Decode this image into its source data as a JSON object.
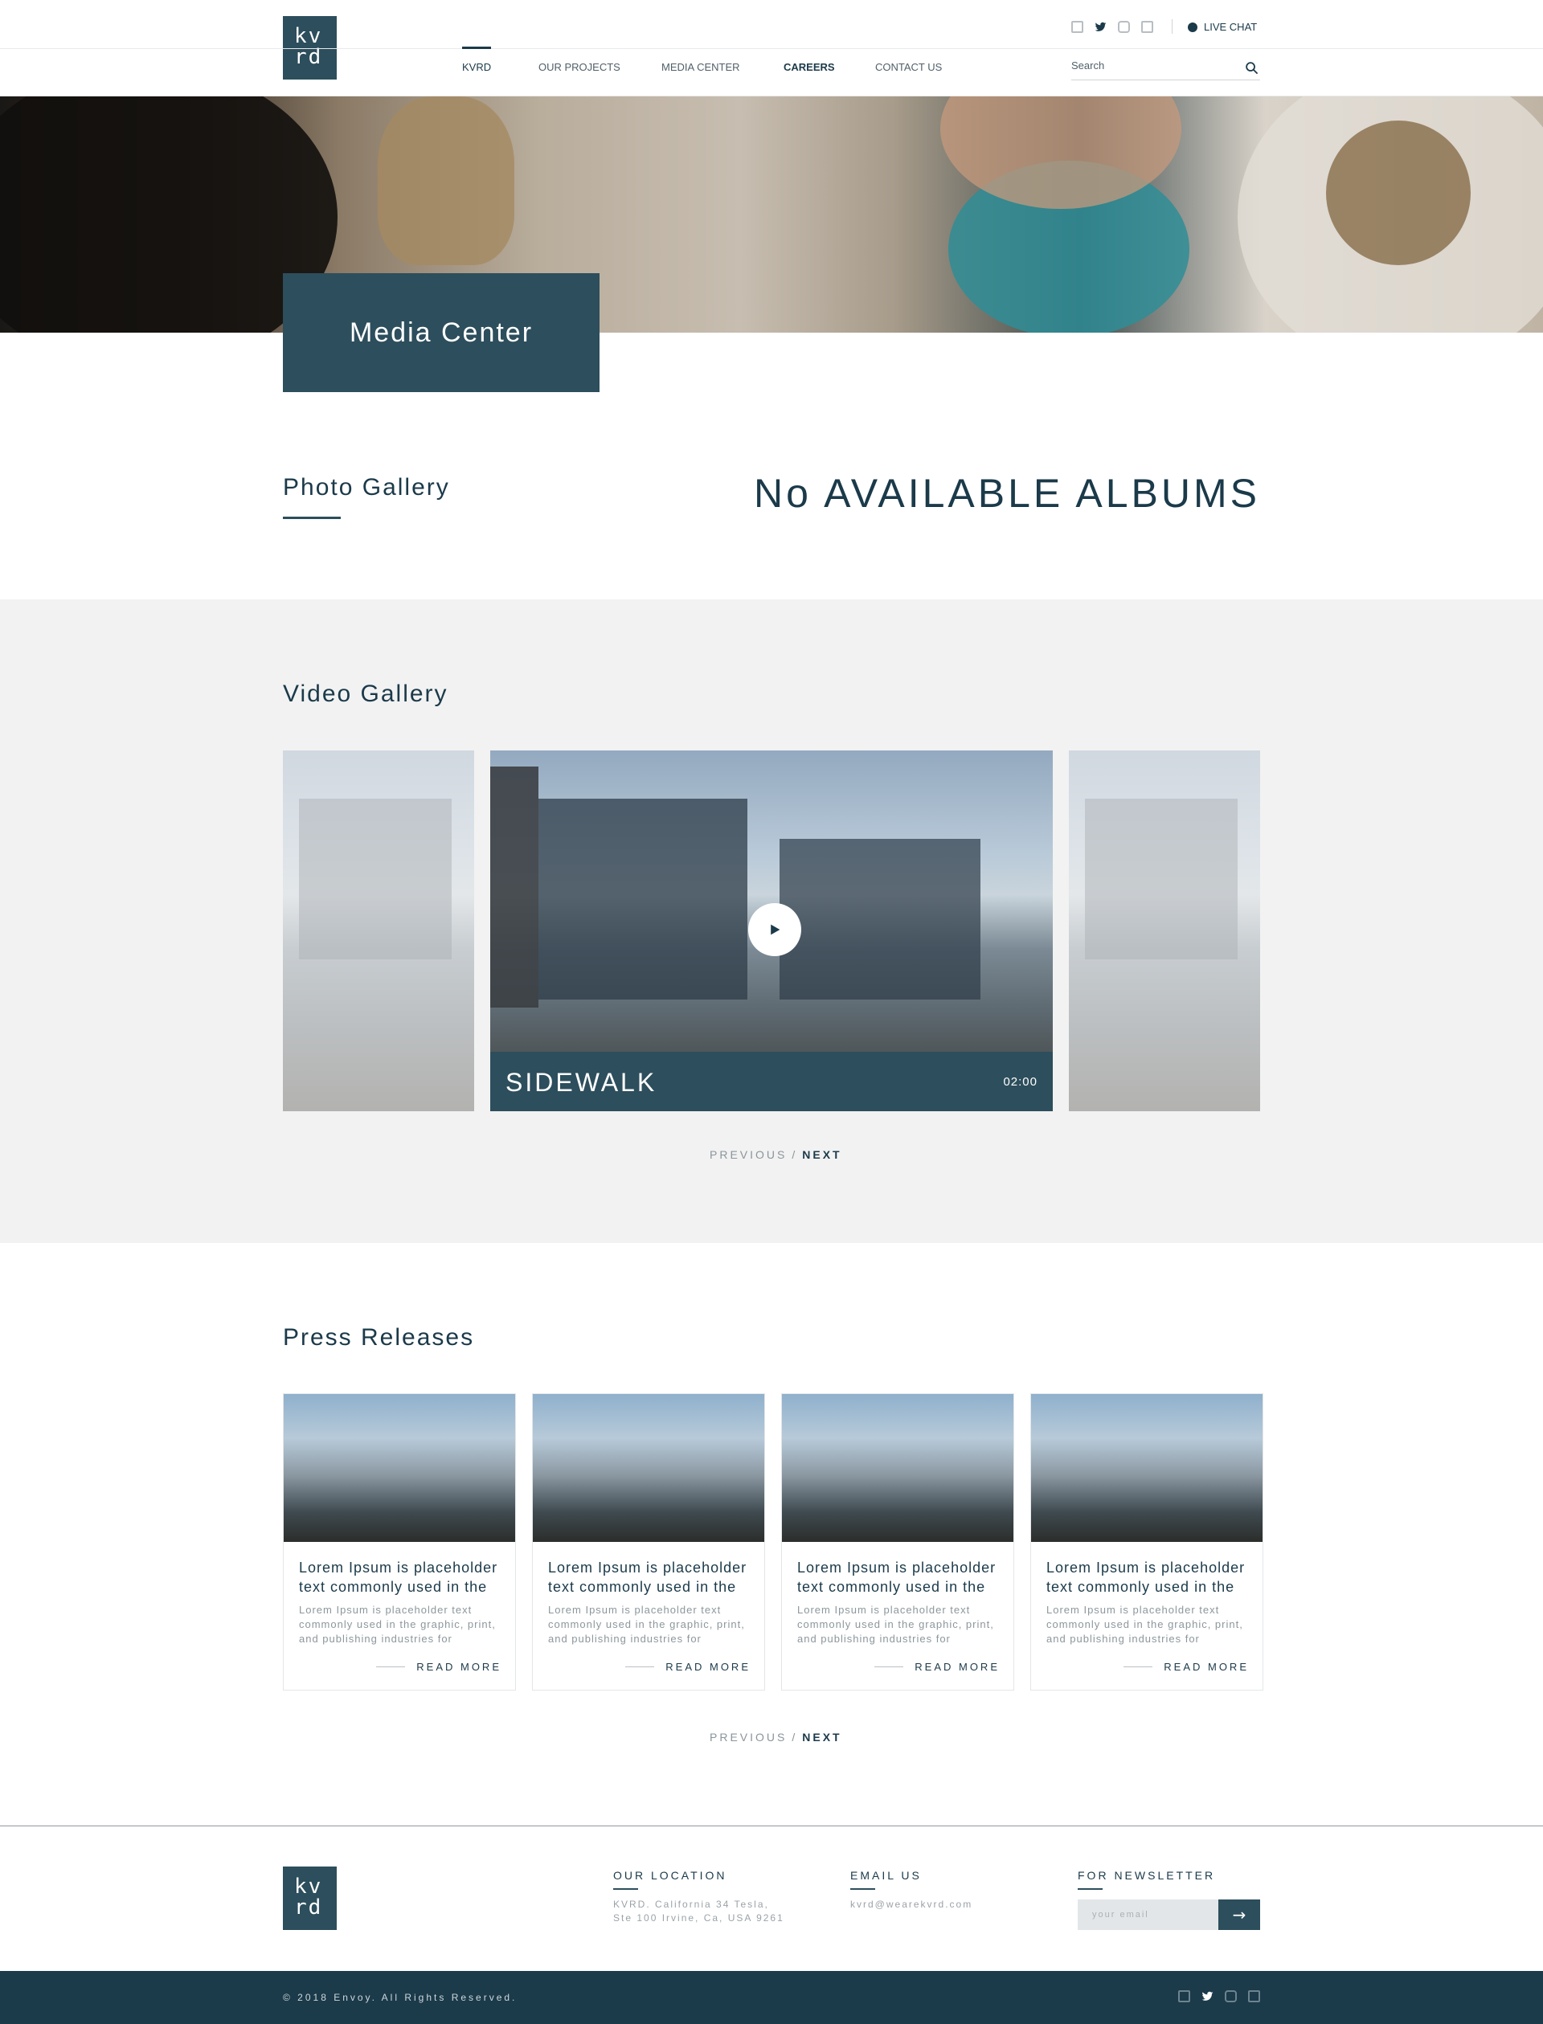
{
  "header": {
    "logo": {
      "line1": "kv",
      "line2": "rd"
    },
    "social": [
      "facebook-icon",
      "twitter-icon",
      "instagram-icon",
      "linkedin-icon"
    ],
    "live_chat": "LIVE CHAT",
    "nav": [
      {
        "label": "KVRD",
        "active": true
      },
      {
        "label": "OUR PROJECTS"
      },
      {
        "label": "MEDIA CENTER"
      },
      {
        "label": "CAREERS"
      },
      {
        "label": "CONTACT US"
      }
    ],
    "search": {
      "placeholder": "Search"
    }
  },
  "hero": {
    "title": "Media Center"
  },
  "photo_gallery": {
    "title": "Photo Gallery",
    "empty_text": "No AVAILABLE ALBUMS"
  },
  "video_gallery": {
    "title": "Video Gallery",
    "featured": {
      "title": "SIDEWALK",
      "duration": "02:00"
    },
    "pager": {
      "prev": "PREVIOUS",
      "separator": "/",
      "next": "NEXT"
    }
  },
  "press": {
    "title": "Press Releases",
    "cards": [
      {
        "title": "Lorem Ipsum is placeholder text commonly used in the",
        "text": "Lorem Ipsum is placeholder text commonly used in the graphic, print, and publishing industries for",
        "more": "READ MORE"
      },
      {
        "title": "Lorem Ipsum is placeholder text commonly used in the",
        "text": "Lorem Ipsum is placeholder text commonly used in the graphic, print, and publishing industries for",
        "more": "READ MORE"
      },
      {
        "title": "Lorem Ipsum is placeholder text commonly used in the",
        "text": "Lorem Ipsum is placeholder text commonly used in the graphic, print, and publishing industries for",
        "more": "READ MORE"
      },
      {
        "title": "Lorem Ipsum is placeholder text commonly used in the",
        "text": "Lorem Ipsum is placeholder text commonly used in the graphic, print, and publishing industries for",
        "more": "READ MORE"
      }
    ],
    "pager": {
      "prev": "PREVIOUS",
      "separator": "/",
      "next": "NEXT"
    }
  },
  "footer": {
    "logo": {
      "line1": "kv",
      "line2": "rd"
    },
    "location": {
      "heading": "OUR LOCATION",
      "line1": "KVRD. California 34 Tesla,",
      "line2": "Ste 100 Irvine, Ca, USA 9261"
    },
    "email": {
      "heading": "EMAIL US",
      "address": "kvrd@wearekvrd.com"
    },
    "newsletter": {
      "heading": "FOR NEWSLETTER",
      "placeholder": "your email",
      "button": "→"
    },
    "copyright": "© 2018 Envoy. All Rights Reserved."
  },
  "colors": {
    "brand": "#1b3a4a",
    "brand_light": "#2d4e5c",
    "section_bg": "#f2f2f2"
  }
}
